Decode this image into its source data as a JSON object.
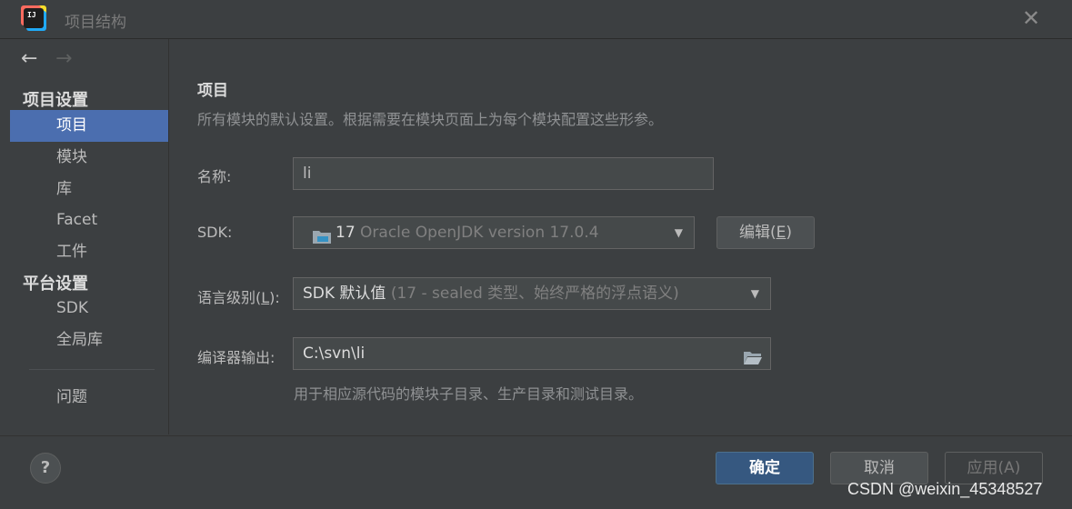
{
  "window": {
    "title": "项目结构",
    "app_icon": "intellij-idea-icon",
    "close_symbol": "✕"
  },
  "nav": {
    "back": "←",
    "forward": "→"
  },
  "sidebar": {
    "project_settings_header": "项目设置",
    "project_items": [
      "项目",
      "模块",
      "库",
      "Facet",
      "工件"
    ],
    "platform_settings_header": "平台设置",
    "platform_items": [
      "SDK",
      "全局库"
    ],
    "problems": "问题",
    "selected": "项目"
  },
  "main": {
    "title": "项目",
    "description": "所有模块的默认设置。根据需要在模块页面上为每个模块配置这些形参。",
    "name": {
      "label": "名称:",
      "value": "li"
    },
    "sdk": {
      "label": "SDK:",
      "version": "17",
      "detail": "Oracle OpenJDK version 17.0.4",
      "edit_label": "编辑(",
      "edit_mnemonic": "E",
      "edit_suffix": ")"
    },
    "language_level": {
      "label_prefix": "语言级别(",
      "label_mnemonic": "L",
      "label_suffix": "):",
      "value_main": "SDK 默认值",
      "value_detail": "(17 - sealed 类型、始终严格的浮点语义)"
    },
    "compiler_output": {
      "label": "编译器输出:",
      "value": "C:\\svn\\li",
      "hint": "用于相应源代码的模块子目录、生产目录和测试目录。"
    }
  },
  "footer": {
    "help": "?",
    "ok": "确定",
    "cancel": "取消",
    "apply": "应用(A)"
  },
  "watermark": "CSDN @weixin_45348527",
  "colors": {
    "background": "#3c3f41",
    "selection": "#4b6eaf",
    "default_button": "#365880",
    "folder_icon": "#9aa7b0",
    "jdk_icon_accent": "#3592c4"
  }
}
